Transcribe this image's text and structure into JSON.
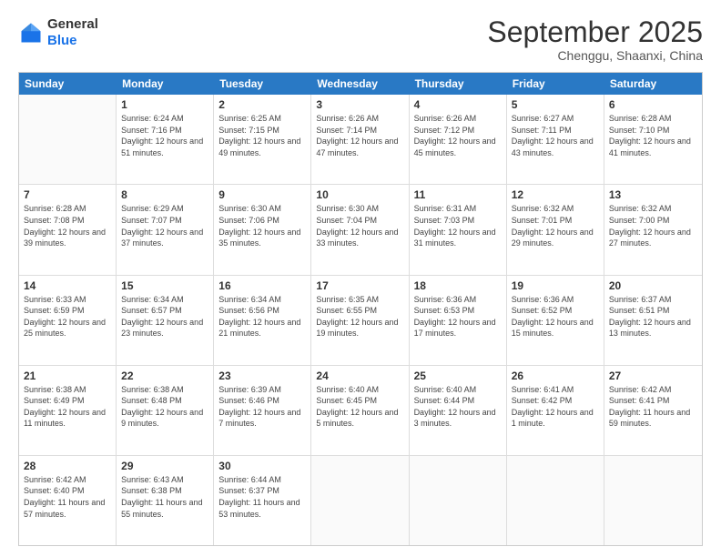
{
  "header": {
    "logo": {
      "line1": "General",
      "line2": "Blue"
    },
    "title": "September 2025",
    "location": "Chenggu, Shaanxi, China"
  },
  "calendar": {
    "days_of_week": [
      "Sunday",
      "Monday",
      "Tuesday",
      "Wednesday",
      "Thursday",
      "Friday",
      "Saturday"
    ],
    "rows": [
      [
        {
          "day": "",
          "empty": true
        },
        {
          "day": "1",
          "sunrise": "Sunrise: 6:24 AM",
          "sunset": "Sunset: 7:16 PM",
          "daylight": "Daylight: 12 hours and 51 minutes."
        },
        {
          "day": "2",
          "sunrise": "Sunrise: 6:25 AM",
          "sunset": "Sunset: 7:15 PM",
          "daylight": "Daylight: 12 hours and 49 minutes."
        },
        {
          "day": "3",
          "sunrise": "Sunrise: 6:26 AM",
          "sunset": "Sunset: 7:14 PM",
          "daylight": "Daylight: 12 hours and 47 minutes."
        },
        {
          "day": "4",
          "sunrise": "Sunrise: 6:26 AM",
          "sunset": "Sunset: 7:12 PM",
          "daylight": "Daylight: 12 hours and 45 minutes."
        },
        {
          "day": "5",
          "sunrise": "Sunrise: 6:27 AM",
          "sunset": "Sunset: 7:11 PM",
          "daylight": "Daylight: 12 hours and 43 minutes."
        },
        {
          "day": "6",
          "sunrise": "Sunrise: 6:28 AM",
          "sunset": "Sunset: 7:10 PM",
          "daylight": "Daylight: 12 hours and 41 minutes."
        }
      ],
      [
        {
          "day": "7",
          "sunrise": "Sunrise: 6:28 AM",
          "sunset": "Sunset: 7:08 PM",
          "daylight": "Daylight: 12 hours and 39 minutes."
        },
        {
          "day": "8",
          "sunrise": "Sunrise: 6:29 AM",
          "sunset": "Sunset: 7:07 PM",
          "daylight": "Daylight: 12 hours and 37 minutes."
        },
        {
          "day": "9",
          "sunrise": "Sunrise: 6:30 AM",
          "sunset": "Sunset: 7:06 PM",
          "daylight": "Daylight: 12 hours and 35 minutes."
        },
        {
          "day": "10",
          "sunrise": "Sunrise: 6:30 AM",
          "sunset": "Sunset: 7:04 PM",
          "daylight": "Daylight: 12 hours and 33 minutes."
        },
        {
          "day": "11",
          "sunrise": "Sunrise: 6:31 AM",
          "sunset": "Sunset: 7:03 PM",
          "daylight": "Daylight: 12 hours and 31 minutes."
        },
        {
          "day": "12",
          "sunrise": "Sunrise: 6:32 AM",
          "sunset": "Sunset: 7:01 PM",
          "daylight": "Daylight: 12 hours and 29 minutes."
        },
        {
          "day": "13",
          "sunrise": "Sunrise: 6:32 AM",
          "sunset": "Sunset: 7:00 PM",
          "daylight": "Daylight: 12 hours and 27 minutes."
        }
      ],
      [
        {
          "day": "14",
          "sunrise": "Sunrise: 6:33 AM",
          "sunset": "Sunset: 6:59 PM",
          "daylight": "Daylight: 12 hours and 25 minutes."
        },
        {
          "day": "15",
          "sunrise": "Sunrise: 6:34 AM",
          "sunset": "Sunset: 6:57 PM",
          "daylight": "Daylight: 12 hours and 23 minutes."
        },
        {
          "day": "16",
          "sunrise": "Sunrise: 6:34 AM",
          "sunset": "Sunset: 6:56 PM",
          "daylight": "Daylight: 12 hours and 21 minutes."
        },
        {
          "day": "17",
          "sunrise": "Sunrise: 6:35 AM",
          "sunset": "Sunset: 6:55 PM",
          "daylight": "Daylight: 12 hours and 19 minutes."
        },
        {
          "day": "18",
          "sunrise": "Sunrise: 6:36 AM",
          "sunset": "Sunset: 6:53 PM",
          "daylight": "Daylight: 12 hours and 17 minutes."
        },
        {
          "day": "19",
          "sunrise": "Sunrise: 6:36 AM",
          "sunset": "Sunset: 6:52 PM",
          "daylight": "Daylight: 12 hours and 15 minutes."
        },
        {
          "day": "20",
          "sunrise": "Sunrise: 6:37 AM",
          "sunset": "Sunset: 6:51 PM",
          "daylight": "Daylight: 12 hours and 13 minutes."
        }
      ],
      [
        {
          "day": "21",
          "sunrise": "Sunrise: 6:38 AM",
          "sunset": "Sunset: 6:49 PM",
          "daylight": "Daylight: 12 hours and 11 minutes."
        },
        {
          "day": "22",
          "sunrise": "Sunrise: 6:38 AM",
          "sunset": "Sunset: 6:48 PM",
          "daylight": "Daylight: 12 hours and 9 minutes."
        },
        {
          "day": "23",
          "sunrise": "Sunrise: 6:39 AM",
          "sunset": "Sunset: 6:46 PM",
          "daylight": "Daylight: 12 hours and 7 minutes."
        },
        {
          "day": "24",
          "sunrise": "Sunrise: 6:40 AM",
          "sunset": "Sunset: 6:45 PM",
          "daylight": "Daylight: 12 hours and 5 minutes."
        },
        {
          "day": "25",
          "sunrise": "Sunrise: 6:40 AM",
          "sunset": "Sunset: 6:44 PM",
          "daylight": "Daylight: 12 hours and 3 minutes."
        },
        {
          "day": "26",
          "sunrise": "Sunrise: 6:41 AM",
          "sunset": "Sunset: 6:42 PM",
          "daylight": "Daylight: 12 hours and 1 minute."
        },
        {
          "day": "27",
          "sunrise": "Sunrise: 6:42 AM",
          "sunset": "Sunset: 6:41 PM",
          "daylight": "Daylight: 11 hours and 59 minutes."
        }
      ],
      [
        {
          "day": "28",
          "sunrise": "Sunrise: 6:42 AM",
          "sunset": "Sunset: 6:40 PM",
          "daylight": "Daylight: 11 hours and 57 minutes."
        },
        {
          "day": "29",
          "sunrise": "Sunrise: 6:43 AM",
          "sunset": "Sunset: 6:38 PM",
          "daylight": "Daylight: 11 hours and 55 minutes."
        },
        {
          "day": "30",
          "sunrise": "Sunrise: 6:44 AM",
          "sunset": "Sunset: 6:37 PM",
          "daylight": "Daylight: 11 hours and 53 minutes."
        },
        {
          "day": "",
          "empty": true
        },
        {
          "day": "",
          "empty": true
        },
        {
          "day": "",
          "empty": true
        },
        {
          "day": "",
          "empty": true
        }
      ]
    ]
  }
}
